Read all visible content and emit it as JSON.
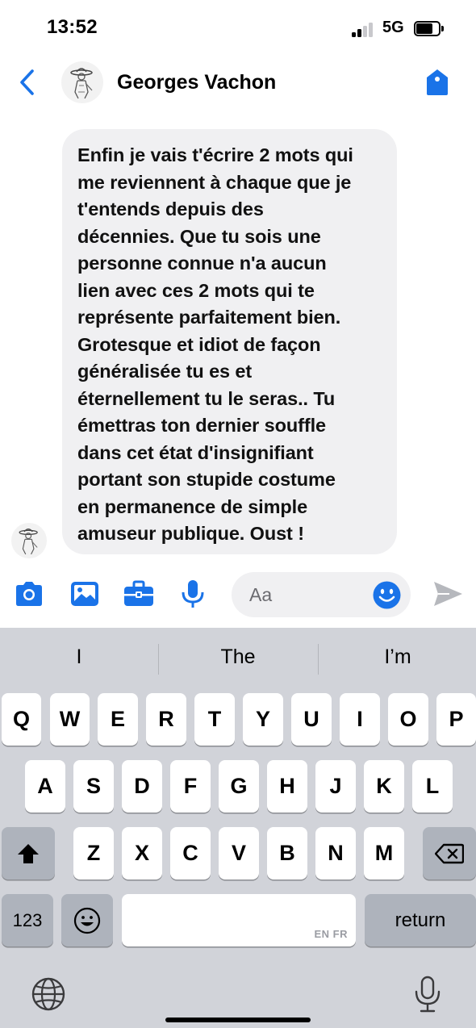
{
  "status_bar": {
    "time": "13:52",
    "network": "5G",
    "signal_bars_filled": 2,
    "signal_bars_total": 4
  },
  "header": {
    "contact_name": "Georges Vachon",
    "accent_color": "#1a73e8"
  },
  "message": {
    "lines": [
      "Enfin je vais t'écrire 2 mots qui",
      "me reviennent à chaque que je",
      "t'entends depuis des",
      "décennies. Que tu sois une",
      "personne connue n'a aucun",
      "lien avec ces 2 mots qui te",
      "représente parfaitement bien.",
      "Grotesque et idiot de façon",
      "généralisée tu es et",
      "éternellement tu le seras.. Tu",
      "émettras ton dernier souffle",
      "dans cet état d'insignifiant",
      "portant son stupide costume",
      "en permanence de simple",
      "amuseur publique. Oust !"
    ]
  },
  "composer": {
    "placeholder": "Aa",
    "icons": [
      "camera-icon",
      "image-icon",
      "briefcase-icon",
      "microphone-icon",
      "emoji-icon",
      "send-icon"
    ]
  },
  "keyboard": {
    "suggestions": [
      "I",
      "The",
      "I’m"
    ],
    "row1": [
      "Q",
      "W",
      "E",
      "R",
      "T",
      "Y",
      "U",
      "I",
      "O",
      "P"
    ],
    "row2": [
      "A",
      "S",
      "D",
      "F",
      "G",
      "H",
      "J",
      "K",
      "L"
    ],
    "row3": [
      "Z",
      "X",
      "C",
      "V",
      "B",
      "N",
      "M"
    ],
    "numbers_label": "123",
    "space_language_hint": "EN FR",
    "return_label": "return"
  }
}
